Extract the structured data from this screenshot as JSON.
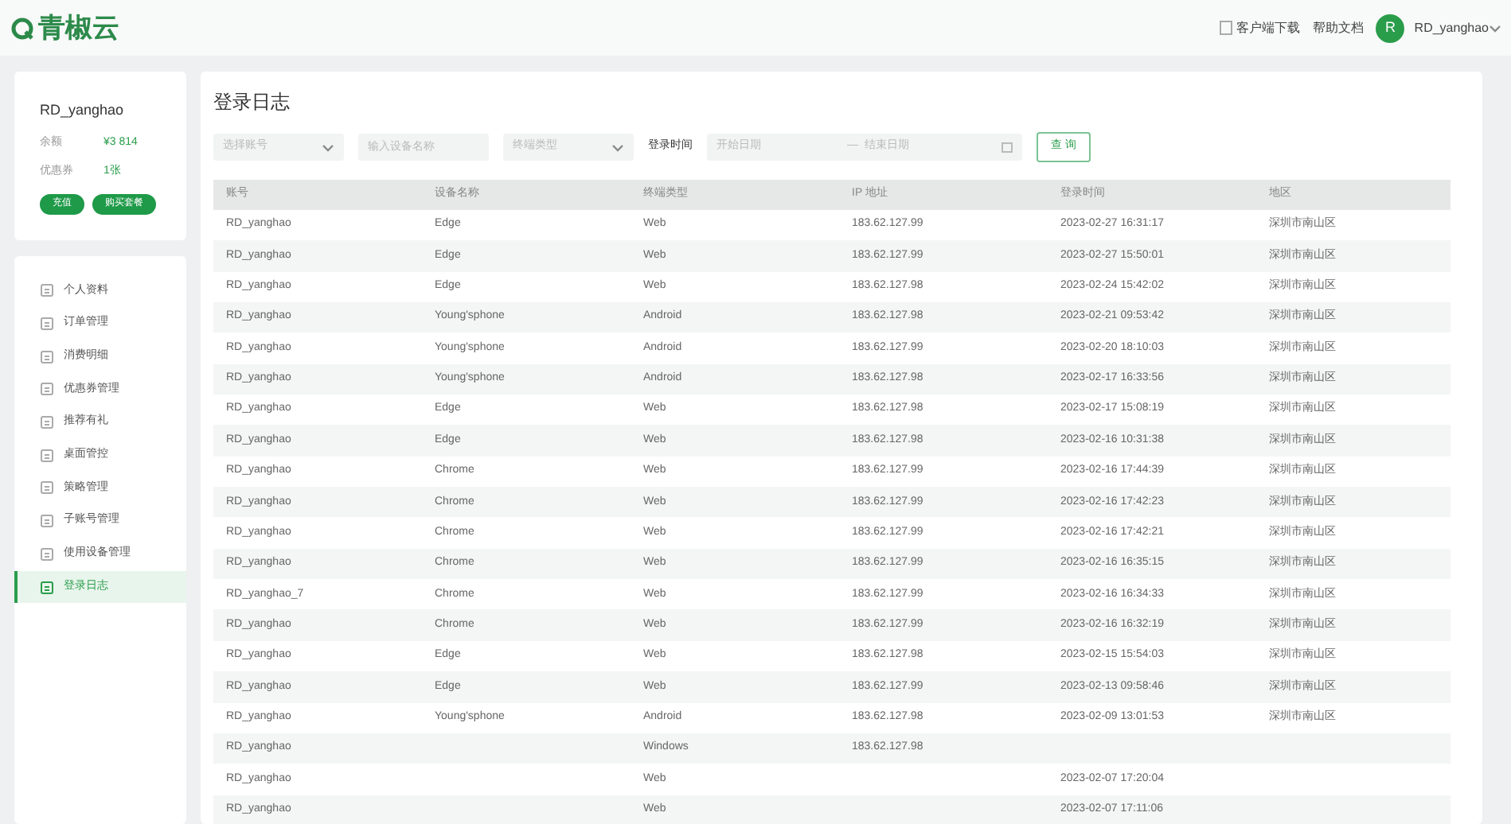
{
  "header": {
    "logo": "青椒云",
    "links": [
      "客户端下载",
      "帮助文档"
    ],
    "avatar": "R",
    "user": "RD_yanghao"
  },
  "account": {
    "name": "RD_yanghao",
    "fields": [
      {
        "label": "余额",
        "value": "¥3 814"
      },
      {
        "label": "优惠券",
        "value": "1张"
      }
    ],
    "buttons": [
      "充值",
      "购买套餐"
    ]
  },
  "sidebar": {
    "items": [
      {
        "label": "个人资料",
        "selected": false
      },
      {
        "label": "订单管理",
        "selected": false
      },
      {
        "label": "消费明细",
        "selected": false
      },
      {
        "label": "优惠券管理",
        "selected": false
      },
      {
        "label": "推荐有礼",
        "selected": false
      },
      {
        "label": "桌面管控",
        "selected": false
      },
      {
        "label": "策略管理",
        "selected": false
      },
      {
        "label": "子账号管理",
        "selected": false
      },
      {
        "label": "使用设备管理",
        "selected": false
      },
      {
        "label": "登录日志",
        "selected": true
      }
    ]
  },
  "page_title": "登录日志",
  "filters": {
    "account": {
      "placeholder": "选择账号"
    },
    "device": {
      "placeholder": "输入设备名称"
    },
    "terminal": {
      "placeholder": "终端类型"
    },
    "time_label": "登录时间",
    "start": {
      "placeholder": "开始日期"
    },
    "separator": "—",
    "end": {
      "placeholder": "结束日期"
    },
    "search_button": "查 询"
  },
  "table": {
    "columns": [
      "账号",
      "设备名称",
      "终端类型",
      "IP 地址",
      "登录时间",
      "地区"
    ],
    "rows": [
      [
        "RD_yanghao",
        "Edge",
        "Web",
        "183.62.127.99",
        "2023-02-27 16:31:17",
        "深圳市南山区"
      ],
      [
        "RD_yanghao",
        "Edge",
        "Web",
        "183.62.127.99",
        "2023-02-27 15:50:01",
        "深圳市南山区"
      ],
      [
        "RD_yanghao",
        "Edge",
        "Web",
        "183.62.127.98",
        "2023-02-24 15:42:02",
        "深圳市南山区"
      ],
      [
        "RD_yanghao",
        "Young'sphone",
        "Android",
        "183.62.127.98",
        "2023-02-21 09:53:42",
        "深圳市南山区"
      ],
      [
        "RD_yanghao",
        "Young'sphone",
        "Android",
        "183.62.127.99",
        "2023-02-20 18:10:03",
        "深圳市南山区"
      ],
      [
        "RD_yanghao",
        "Young'sphone",
        "Android",
        "183.62.127.98",
        "2023-02-17 16:33:56",
        "深圳市南山区"
      ],
      [
        "RD_yanghao",
        "Edge",
        "Web",
        "183.62.127.98",
        "2023-02-17 15:08:19",
        "深圳市南山区"
      ],
      [
        "RD_yanghao",
        "Edge",
        "Web",
        "183.62.127.98",
        "2023-02-16 10:31:38",
        "深圳市南山区"
      ],
      [
        "RD_yanghao",
        "Chrome",
        "Web",
        "183.62.127.99",
        "2023-02-16 17:44:39",
        "深圳市南山区"
      ],
      [
        "RD_yanghao",
        "Chrome",
        "Web",
        "183.62.127.99",
        "2023-02-16 17:42:23",
        "深圳市南山区"
      ],
      [
        "RD_yanghao",
        "Chrome",
        "Web",
        "183.62.127.99",
        "2023-02-16 17:42:21",
        "深圳市南山区"
      ],
      [
        "RD_yanghao",
        "Chrome",
        "Web",
        "183.62.127.99",
        "2023-02-16 16:35:15",
        "深圳市南山区"
      ],
      [
        "RD_yanghao_7",
        "Chrome",
        "Web",
        "183.62.127.99",
        "2023-02-16 16:34:33",
        "深圳市南山区"
      ],
      [
        "RD_yanghao",
        "Chrome",
        "Web",
        "183.62.127.99",
        "2023-02-16 16:32:19",
        "深圳市南山区"
      ],
      [
        "RD_yanghao",
        "Edge",
        "Web",
        "183.62.127.98",
        "2023-02-15 15:54:03",
        "深圳市南山区"
      ],
      [
        "RD_yanghao",
        "Edge",
        "Web",
        "183.62.127.99",
        "2023-02-13 09:58:46",
        "深圳市南山区"
      ],
      [
        "RD_yanghao",
        "Young'sphone",
        "Android",
        "183.62.127.98",
        "2023-02-09 13:01:53",
        "深圳市南山区"
      ],
      [
        "RD_yanghao",
        "",
        "Windows",
        "183.62.127.98",
        "",
        ""
      ],
      [
        "RD_yanghao",
        "",
        "Web",
        "",
        "2023-02-07 17:20:04",
        ""
      ],
      [
        "RD_yanghao",
        "",
        "Web",
        "",
        "2023-02-07 17:11:06",
        ""
      ]
    ]
  }
}
